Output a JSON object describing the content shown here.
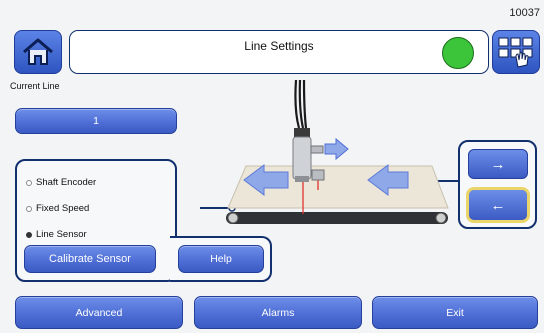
{
  "header": {
    "code": "10037",
    "title": "Line Settings",
    "status_color": "#3cc43a"
  },
  "current_line": {
    "label": "Current Line",
    "value": "1"
  },
  "mode": {
    "options": [
      {
        "label": "Shaft Encoder",
        "selected": false
      },
      {
        "label": "Fixed Speed",
        "selected": false
      },
      {
        "label": "Line Sensor",
        "selected": true
      }
    ],
    "calibrate_label": "Calibrate Sensor",
    "help_label": "Help"
  },
  "direction": {
    "right_symbol": "→",
    "left_symbol": "←",
    "selected": "left"
  },
  "footer": {
    "advanced_label": "Advanced",
    "alarms_label": "Alarms",
    "exit_label": "Exit"
  },
  "colors": {
    "button_blue": "#4f6fd6",
    "frame_navy": "#12306e",
    "status_green": "#3cc43a",
    "selection_yellow": "#e9d56a"
  },
  "icons": [
    "home-icon",
    "grid-hand-icon",
    "sensor-icon",
    "conveyor-icon",
    "arrow-left-icon"
  ]
}
